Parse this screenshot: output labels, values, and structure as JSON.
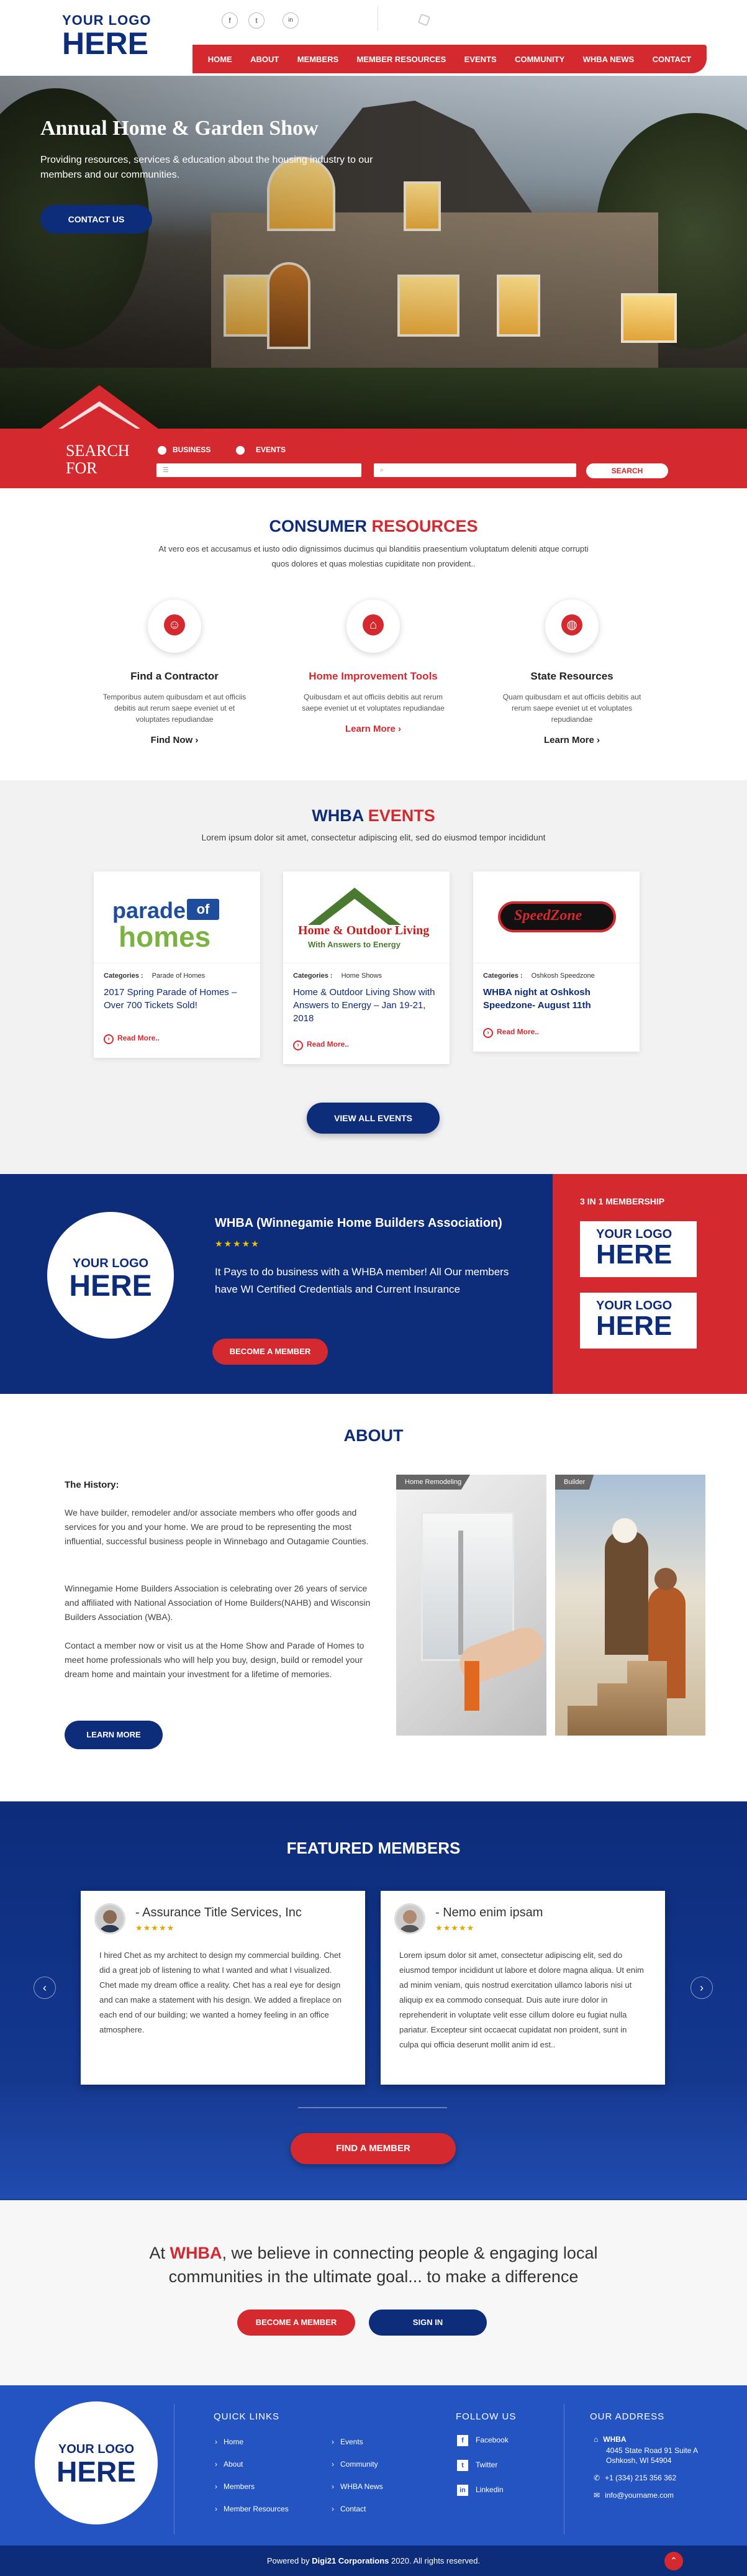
{
  "header": {
    "logo_small": "YOUR LOGO",
    "logo_big": "HERE",
    "social": [
      "f",
      "t",
      "in"
    ],
    "nav": [
      "HOME",
      "ABOUT",
      "MEMBERS",
      "MEMBER RESOURCES",
      "EVENTS",
      "COMMUNITY",
      "WHBA NEWS",
      "CONTACT"
    ]
  },
  "hero": {
    "title": "Annual Home & Garden Show",
    "subtitle": "Providing resources, services & education about the housing industry to our members and our communities.",
    "button": "CONTACT US"
  },
  "search": {
    "label_line1": "SEARCH",
    "label_line2": "FOR",
    "radio_business": "BUSINESS",
    "radio_events": "EVENTS",
    "button": "SEARCH"
  },
  "consumer": {
    "title_a": "CONSUMER",
    "title_b": "RESOURCES",
    "text": "At vero eos et accusamus et iusto odio dignissimos ducimus qui blanditiis praesentium voluptatum deleniti atque corrupti quos dolores et quas molestias  cupiditate non provident..",
    "items": [
      {
        "title": "Find a Contractor",
        "text": "Temporibus autem quibusdam et aut officiis debitis aut rerum saepe eveniet ut et voluptates repudiandae",
        "link": "Find Now ›"
      },
      {
        "title": "Home Improvement Tools",
        "text": "Quibusdam et aut officiis debitis aut rerum saepe eveniet ut et voluptates repudiandae",
        "link": "Learn More ›"
      },
      {
        "title": "State Resources",
        "text": "Quam quibusdam et aut officiis debitis aut rerum saepe eveniet ut et voluptates repudiandae",
        "link": "Learn More ›"
      }
    ]
  },
  "events": {
    "title_a": "WHBA",
    "title_b": "EVENTS",
    "subtitle": "Lorem ipsum dolor sit amet, consectetur adipiscing elit, sed do eiusmod tempor incididunt",
    "cards": [
      {
        "cat_label": "Categories :",
        "cat": "Parade of Homes",
        "title": "2017 Spring Parade of Homes – Over 700 Tickets Sold!",
        "read": "Read More..",
        "img_text_a": "parade",
        "img_text_b": "of",
        "img_text_c": "homes"
      },
      {
        "cat_label": "Categories :",
        "cat": "Home Shows",
        "title": "Home & Outdoor Living Show with Answers to Energy – Jan 19-21, 2018",
        "read": "Read More..",
        "img_text_a": "Home & Outdoor Living",
        "img_text_b": "With Answers to Energy",
        "img_text_c": ""
      },
      {
        "cat_label": "Categories :",
        "cat": "Oshkosh Speedzone",
        "title": "WHBA night at Oshkosh Speedzone- August 11th",
        "read": "Read More..",
        "img_text_a": "SpeedZone",
        "img_text_b": "",
        "img_text_c": ""
      }
    ],
    "view_all": "VIEW ALL EVENTS"
  },
  "membership": {
    "logo_small": "YOUR LOGO",
    "logo_big": "HERE",
    "title": "WHBA (Winnegamie Home Builders Association)",
    "stars": "★★★★★",
    "text": "It Pays to do business with a WHBA member! All Our members have WI Certified Credentials and Current Insurance",
    "button": "BECOME A MEMBER",
    "side_title": "3 IN 1 MEMBERSHIP",
    "side_logo_small": "YOUR LOGO",
    "side_logo_big": "HERE"
  },
  "about": {
    "title": "ABOUT",
    "history": "The History:",
    "p1": "We have builder, remodeler and/or associate members who offer goods and services for you and your home.  We are proud to be representing the most influential, successful business people in Winnebago and Outagamie Counties.",
    "p2": "Winnegamie Home Builders Association is celebrating over 26 years of service and affiliated with National Association of Home Builders(NAHB) and Wisconsin Builders Association (WBA).",
    "p3": "Contact a member now or visit us at the Home Show and Parade of Homes to meet home professionals who will help you buy, design, build or remodel your dream home and maintain your investment for a lifetime of memories.",
    "button": "LEARN MORE",
    "tag1": "Home Remodeling",
    "tag2": "Builder"
  },
  "featured": {
    "title": "FEATURED MEMBERS",
    "cards": [
      {
        "name": "- Assurance Title Services, Inc",
        "stars": "★★★★★",
        "text": "I hired Chet as my architect to design my commercial building. Chet did a great job of listening to what I wanted and what I visualized. Chet made my dream office a reality. Chet has a real eye for design and can make a statement with his design. We added a fireplace on each end of our building; we wanted a homey feeling in an office atmosphere."
      },
      {
        "name": "- Nemo enim ipsam",
        "stars": "★★★★★",
        "text": "Lorem ipsum dolor sit amet, consectetur adipiscing elit, sed do eiusmod tempor incididunt ut labore et dolore magna aliqua. Ut enim ad minim veniam, quis nostrud exercitation ullamco laboris nisi ut aliquip ex ea commodo consequat. Duis aute irure dolor in reprehenderit in voluptate velit esse cillum dolore eu fugiat nulla pariatur. Excepteur sint occaecat cupidatat non proident, sunt in culpa qui officia deserunt mollit anim id est.."
      }
    ],
    "button": "FIND A MEMBER"
  },
  "tagline": {
    "pre": "At",
    "brand": "WHBA",
    "rest": ", we believe in connecting people & engaging local communities in the ultimate goal... to make a difference",
    "become": "BECOME A MEMBER",
    "signin": "SIGN IN"
  },
  "footer": {
    "logo_small": "YOUR LOGO",
    "logo_big": "HERE",
    "quick_links_title": "QUICK LINKS",
    "links_col1": [
      "Home",
      "About",
      "Members",
      "Member Resources"
    ],
    "links_col2": [
      "Events",
      "Community",
      "WHBA News",
      "Contact"
    ],
    "follow_title": "FOLLOW US",
    "follow": [
      "Facebook",
      "Twitter",
      "Linkedin"
    ],
    "address_title": "OUR ADDRESS",
    "org": "WHBA",
    "addr1": "4045 State Road 91 Suite A",
    "addr2": "Oshkosh, WI 54904",
    "phone": "+1 (334) 215 356 362",
    "email": "info@yourname.com",
    "copyright_pre": "Powered by",
    "copyright_brand": "Digi21 Corporations",
    "copyright_post": "2020. All rights reserved."
  }
}
